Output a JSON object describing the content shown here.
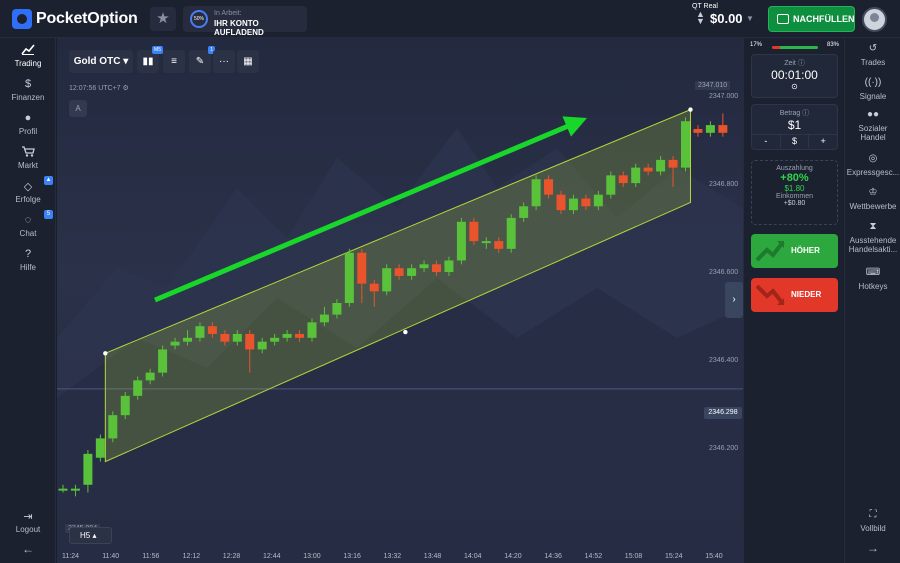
{
  "brand": {
    "name": "PocketOption"
  },
  "status": {
    "percent": "50%",
    "line1": "In Arbeit:",
    "line2": "IHR KONTO AUFLADEND"
  },
  "account": {
    "type": "QT Real",
    "balance": "$0.00",
    "topup_label": "NACHFÜLLEN"
  },
  "left_nav": [
    {
      "label": "Trading",
      "icon": "chart-line-icon"
    },
    {
      "label": "Finanzen",
      "icon": "dollar-icon"
    },
    {
      "label": "Profil",
      "icon": "user-icon"
    },
    {
      "label": "Markt",
      "icon": "cart-icon"
    },
    {
      "label": "Erfolge",
      "icon": "diamond-icon",
      "badge": "▲"
    },
    {
      "label": "Chat",
      "icon": "chat-icon",
      "badge": "5"
    },
    {
      "label": "Hilfe",
      "icon": "help-icon"
    }
  ],
  "logout_label": "Logout",
  "toolbar": {
    "asset": "Gold OTC",
    "indicator_badge": "M5",
    "drawing_badge": "1"
  },
  "chart_meta": {
    "time": "12:07:56",
    "timezone": "UTC+7",
    "drawing_label": "A",
    "timeframe": "H5"
  },
  "chart_data": {
    "type": "candlestick",
    "x_ticks": [
      "11:24",
      "11:40",
      "11:56",
      "12:12",
      "12:28",
      "12:44",
      "13:00",
      "13:16",
      "13:32",
      "13:48",
      "14:04",
      "14:20",
      "14:36",
      "14:52",
      "15:08",
      "15:24",
      "15:40"
    ],
    "y_ticks": [
      "2347.000",
      "2346.800",
      "2346.600",
      "2346.400",
      "2346.200"
    ],
    "y_top_label": "2347.010",
    "y_bottom_label": "2345.994",
    "current_price": "2346.298",
    "ylim": [
      2345.99,
      2347.05
    ],
    "candles": [
      {
        "o": 2346.04,
        "c": 2346.04,
        "h": 2346.05,
        "l": 2346.03
      },
      {
        "o": 2346.04,
        "c": 2346.04,
        "h": 2346.05,
        "l": 2346.02
      },
      {
        "o": 2346.05,
        "c": 2346.13,
        "h": 2346.14,
        "l": 2346.03
      },
      {
        "o": 2346.12,
        "c": 2346.17,
        "h": 2346.18,
        "l": 2346.11
      },
      {
        "o": 2346.17,
        "c": 2346.23,
        "h": 2346.24,
        "l": 2346.16
      },
      {
        "o": 2346.23,
        "c": 2346.28,
        "h": 2346.29,
        "l": 2346.22
      },
      {
        "o": 2346.28,
        "c": 2346.32,
        "h": 2346.33,
        "l": 2346.27
      },
      {
        "o": 2346.32,
        "c": 2346.34,
        "h": 2346.35,
        "l": 2346.31
      },
      {
        "o": 2346.34,
        "c": 2346.4,
        "h": 2346.41,
        "l": 2346.33
      },
      {
        "o": 2346.41,
        "c": 2346.42,
        "h": 2346.43,
        "l": 2346.4
      },
      {
        "o": 2346.42,
        "c": 2346.43,
        "h": 2346.45,
        "l": 2346.41
      },
      {
        "o": 2346.43,
        "c": 2346.46,
        "h": 2346.47,
        "l": 2346.42
      },
      {
        "o": 2346.46,
        "c": 2346.44,
        "h": 2346.47,
        "l": 2346.43
      },
      {
        "o": 2346.44,
        "c": 2346.42,
        "h": 2346.45,
        "l": 2346.41
      },
      {
        "o": 2346.42,
        "c": 2346.44,
        "h": 2346.45,
        "l": 2346.41
      },
      {
        "o": 2346.44,
        "c": 2346.4,
        "h": 2346.45,
        "l": 2346.34
      },
      {
        "o": 2346.4,
        "c": 2346.42,
        "h": 2346.43,
        "l": 2346.39
      },
      {
        "o": 2346.42,
        "c": 2346.43,
        "h": 2346.44,
        "l": 2346.41
      },
      {
        "o": 2346.43,
        "c": 2346.44,
        "h": 2346.45,
        "l": 2346.42
      },
      {
        "o": 2346.44,
        "c": 2346.43,
        "h": 2346.45,
        "l": 2346.42
      },
      {
        "o": 2346.43,
        "c": 2346.47,
        "h": 2346.48,
        "l": 2346.42
      },
      {
        "o": 2346.47,
        "c": 2346.49,
        "h": 2346.51,
        "l": 2346.46
      },
      {
        "o": 2346.49,
        "c": 2346.52,
        "h": 2346.53,
        "l": 2346.48
      },
      {
        "o": 2346.52,
        "c": 2346.65,
        "h": 2346.66,
        "l": 2346.51
      },
      {
        "o": 2346.65,
        "c": 2346.57,
        "h": 2346.66,
        "l": 2346.52
      },
      {
        "o": 2346.57,
        "c": 2346.55,
        "h": 2346.58,
        "l": 2346.51
      },
      {
        "o": 2346.55,
        "c": 2346.61,
        "h": 2346.62,
        "l": 2346.54
      },
      {
        "o": 2346.61,
        "c": 2346.59,
        "h": 2346.62,
        "l": 2346.58
      },
      {
        "o": 2346.59,
        "c": 2346.61,
        "h": 2346.62,
        "l": 2346.58
      },
      {
        "o": 2346.61,
        "c": 2346.62,
        "h": 2346.63,
        "l": 2346.6
      },
      {
        "o": 2346.62,
        "c": 2346.6,
        "h": 2346.63,
        "l": 2346.59
      },
      {
        "o": 2346.6,
        "c": 2346.63,
        "h": 2346.64,
        "l": 2346.59
      },
      {
        "o": 2346.63,
        "c": 2346.73,
        "h": 2346.74,
        "l": 2346.62
      },
      {
        "o": 2346.73,
        "c": 2346.68,
        "h": 2346.74,
        "l": 2346.67
      },
      {
        "o": 2346.68,
        "c": 2346.68,
        "h": 2346.69,
        "l": 2346.66
      },
      {
        "o": 2346.68,
        "c": 2346.66,
        "h": 2346.69,
        "l": 2346.65
      },
      {
        "o": 2346.66,
        "c": 2346.74,
        "h": 2346.75,
        "l": 2346.65
      },
      {
        "o": 2346.74,
        "c": 2346.77,
        "h": 2346.78,
        "l": 2346.73
      },
      {
        "o": 2346.77,
        "c": 2346.84,
        "h": 2346.85,
        "l": 2346.76
      },
      {
        "o": 2346.84,
        "c": 2346.8,
        "h": 2346.85,
        "l": 2346.79
      },
      {
        "o": 2346.8,
        "c": 2346.76,
        "h": 2346.81,
        "l": 2346.75
      },
      {
        "o": 2346.76,
        "c": 2346.79,
        "h": 2346.8,
        "l": 2346.75
      },
      {
        "o": 2346.79,
        "c": 2346.77,
        "h": 2346.8,
        "l": 2346.76
      },
      {
        "o": 2346.77,
        "c": 2346.8,
        "h": 2346.81,
        "l": 2346.76
      },
      {
        "o": 2346.8,
        "c": 2346.85,
        "h": 2346.86,
        "l": 2346.79
      },
      {
        "o": 2346.85,
        "c": 2346.83,
        "h": 2346.86,
        "l": 2346.82
      },
      {
        "o": 2346.83,
        "c": 2346.87,
        "h": 2346.88,
        "l": 2346.82
      },
      {
        "o": 2346.87,
        "c": 2346.86,
        "h": 2346.88,
        "l": 2346.85
      },
      {
        "o": 2346.86,
        "c": 2346.89,
        "h": 2346.9,
        "l": 2346.85
      },
      {
        "o": 2346.89,
        "c": 2346.87,
        "h": 2346.9,
        "l": 2346.82
      },
      {
        "o": 2346.87,
        "c": 2346.99,
        "h": 2347.0,
        "l": 2346.86
      },
      {
        "o": 2346.97,
        "c": 2346.96,
        "h": 2346.98,
        "l": 2346.95
      },
      {
        "o": 2346.96,
        "c": 2346.98,
        "h": 2346.99,
        "l": 2346.95
      },
      {
        "o": 2346.98,
        "c": 2346.96,
        "h": 2347.01,
        "l": 2346.95
      }
    ]
  },
  "trade_panel": {
    "sentiment_low": "17%",
    "sentiment_high": "83%",
    "sentiment_up": 0.83,
    "time_label": "Zeit",
    "time_value": "00:01:00",
    "amount_label": "Betrag",
    "amount_value": "$1",
    "minus": "-",
    "currency": "$",
    "plus": "+",
    "payout_label": "Auszahlung",
    "payout_percent": "+80%",
    "payout_amount": "$1.80",
    "income_label": "Einkommen",
    "income_value": "+$0.80",
    "higher_label": "HÖHER",
    "lower_label": "NIEDER"
  },
  "right_nav": [
    {
      "label": "Trades",
      "icon": "history-icon"
    },
    {
      "label": "Signale",
      "icon": "signal-icon"
    },
    {
      "label": "Sozialer Handel",
      "icon": "people-icon"
    },
    {
      "label": "Expressgesc...",
      "icon": "target-icon"
    },
    {
      "label": "Wettbewerbe",
      "icon": "trophy-icon"
    },
    {
      "label": "Ausstehende Handelsakti...",
      "icon": "hourglass-icon"
    },
    {
      "label": "Hotkeys",
      "icon": "keyboard-icon"
    }
  ],
  "fullscreen_label": "Vollbild",
  "colors": {
    "up": "#59c23a",
    "down": "#e9542d",
    "channel": "#b5d83a",
    "arrow": "#18d62a",
    "accent": "#2f6ef7"
  }
}
